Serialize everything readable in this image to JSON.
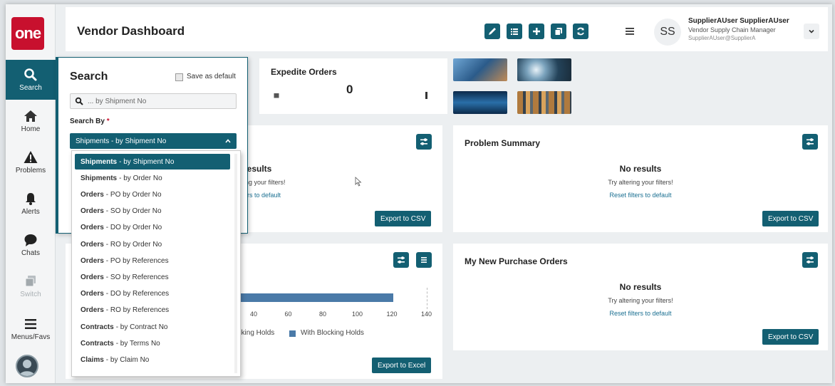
{
  "app": {
    "logo_text": "one"
  },
  "nav": [
    {
      "label": "Search",
      "icon": "search-icon",
      "active": true
    },
    {
      "label": "Home",
      "icon": "home-icon"
    },
    {
      "label": "Problems",
      "icon": "warning-icon"
    },
    {
      "label": "Alerts",
      "icon": "bell-icon"
    },
    {
      "label": "Chats",
      "icon": "chat-icon"
    },
    {
      "label": "Switch",
      "icon": "switch-icon",
      "disabled": true
    },
    {
      "label": "Menus/Favs",
      "icon": "menu-icon"
    }
  ],
  "header": {
    "title": "Vendor Dashboard",
    "user_initials": "SS",
    "user_name": "SupplierAUser SupplierAUser",
    "user_role": "Vendor Supply Chain Manager",
    "user_email": "SupplierAUser@SupplierA"
  },
  "search": {
    "title": "Search",
    "save_default_label": "Save as default",
    "placeholder": "... by Shipment No",
    "search_by_label": "Search By",
    "required_mark": "*",
    "selected_value": "Shipments - by Shipment No",
    "options": [
      {
        "bold": "Shipments",
        "rest": "- by Shipment No"
      },
      {
        "bold": "Shipments",
        "rest": "- by Order No"
      },
      {
        "bold": "Orders",
        "rest": "- PO by Order No"
      },
      {
        "bold": "Orders",
        "rest": "- SO by Order No"
      },
      {
        "bold": "Orders",
        "rest": "- DO by Order No"
      },
      {
        "bold": "Orders",
        "rest": "- RO by Order No"
      },
      {
        "bold": "Orders",
        "rest": "- PO by References"
      },
      {
        "bold": "Orders",
        "rest": "- SO by References"
      },
      {
        "bold": "Orders",
        "rest": "- DO by References"
      },
      {
        "bold": "Orders",
        "rest": "- RO by References"
      },
      {
        "bold": "Contracts",
        "rest": "- by Contract No"
      },
      {
        "bold": "Contracts",
        "rest": "- by Terms No"
      },
      {
        "bold": "Claims",
        "rest": "- by Claim No"
      }
    ]
  },
  "expedite": {
    "title": "Expedite Orders",
    "value": "0"
  },
  "left_card": {
    "no_results_partial": "results",
    "try_partial": "ing your filters!",
    "reset_partial": "ers to default",
    "export_label": "Export to CSV"
  },
  "problem_summary": {
    "title": "Problem Summary",
    "no_results": "No results",
    "try_text": "Try altering your filters!",
    "reset_text": "Reset filters to default",
    "export_label": "Export to CSV"
  },
  "purchase_orders": {
    "title": "My New Purchase Orders",
    "no_results": "No results",
    "try_text": "Try altering your filters!",
    "reset_text": "Reset filters to default",
    "export_label": "Export to CSV"
  },
  "holds_chart": {
    "export_label": "Export to Excel",
    "legend_partial": "ocking Holds",
    "legend_with": "With Blocking Holds",
    "ticks": [
      "40",
      "60",
      "80",
      "100",
      "120",
      "140"
    ],
    "bar_end_value": 121,
    "bar_color": "#4a7aa8"
  },
  "colors": {
    "accent": "#135f72",
    "logo": "#c8102e",
    "link": "#1a6f91"
  }
}
